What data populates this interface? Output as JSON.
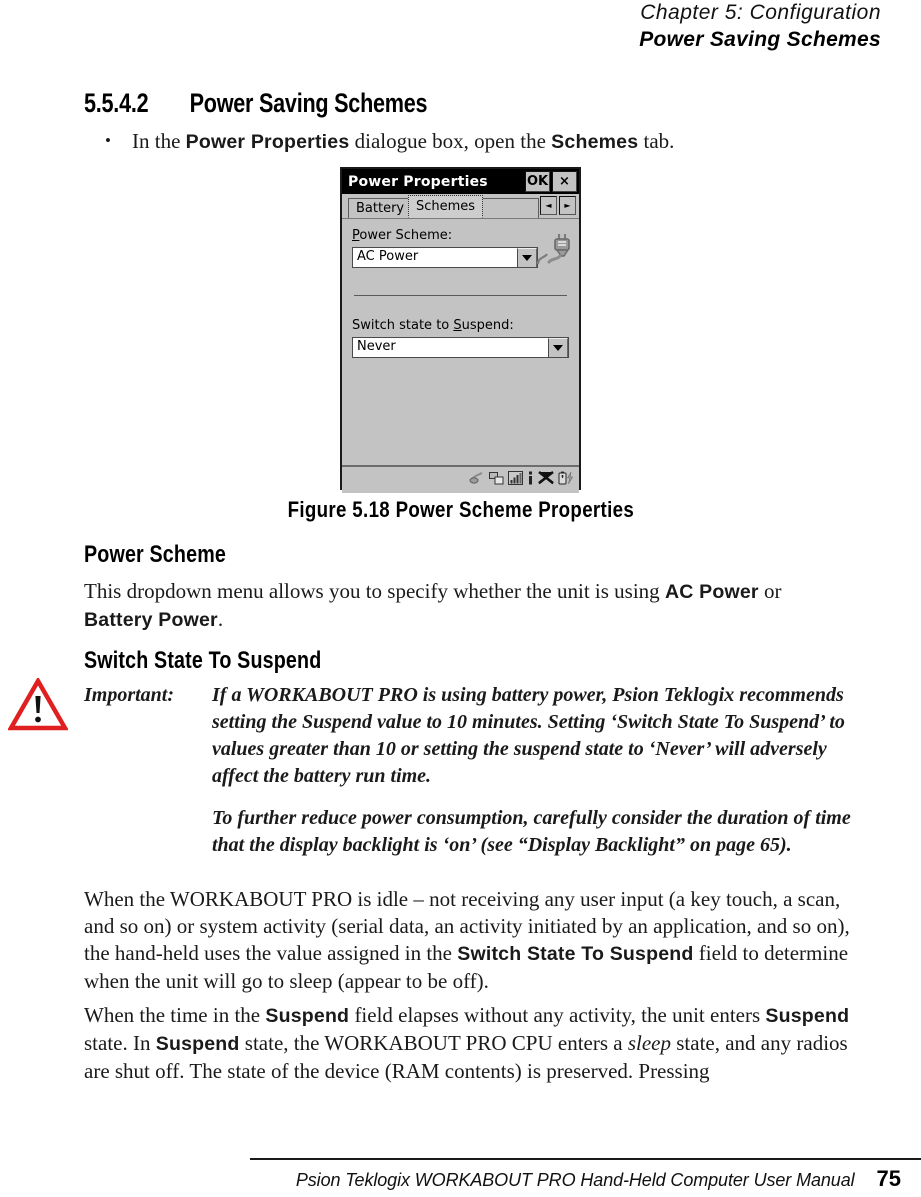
{
  "running_head": {
    "line1": "Chapter 5: Configuration",
    "line2": "Power Saving Schemes"
  },
  "section": {
    "number": "5.5.4.2",
    "title": "Power Saving Schemes"
  },
  "bullet": {
    "marker": "•",
    "text_before": "In the ",
    "term1": "Power Properties",
    "text_middle": " dialogue box, open the ",
    "term2": "Schemes",
    "text_after": " tab."
  },
  "dialog": {
    "title": "Power Properties",
    "ok_label": "OK",
    "close_label": "×",
    "tabs": [
      {
        "label": "Battery",
        "active": false
      },
      {
        "label": "Schemes",
        "active": true
      }
    ],
    "tab_scroll_left": "◄",
    "tab_scroll_right": "►",
    "fields": [
      {
        "label_pre": "P",
        "label_rest": "ower Scheme:",
        "value": "AC Power"
      },
      {
        "label_pre": "S",
        "label_rest": "witch state to ",
        "label_underline": "S",
        "label_tail": "uspend:",
        "value": "Never"
      }
    ],
    "switch_label_full": "Switch state to Suspend:",
    "tray_icons": [
      "speaker-icon",
      "network-connection-icon",
      "signal-strength-icon",
      "info-icon",
      "radio-disabled-icon",
      "battery-charging-icon"
    ],
    "plug_icon": "ac-plug-icon"
  },
  "figure": {
    "caption": "Figure 5.18  Power Scheme Properties"
  },
  "headings": {
    "power_scheme": "Power Scheme",
    "switch_state": "Switch State To Suspend"
  },
  "paragraphs": {
    "power_scheme": {
      "p1": "This dropdown menu allows you to specify whether the unit is using ",
      "term1": "AC Power",
      "p2": " or ",
      "term2": "Battery Power",
      "p3": "."
    },
    "when_idle": {
      "p1": "When the WORKABOUT PRO is idle – not receiving any user input (a key touch, a scan, and so on) or system activity (serial data, an activity initiated by an application, and so on), the hand-held uses the value assigned in the ",
      "term1": "Switch State To Suspend",
      "p2": " field to determine when the unit will go to sleep (appear to be off)."
    },
    "when_time": {
      "p1": "When the time in the ",
      "term1": "Suspend",
      "p2": " field elapses without any activity, the unit enters ",
      "term2": "Suspend",
      "p3": " state. In ",
      "term3": "Suspend",
      "p4": " state, the WORKABOUT PRO CPU enters a ",
      "italic1": "sleep",
      "p5": " state, and any radios are shut off. The state of the device (RAM contents) is preserved. Pressing"
    }
  },
  "important": {
    "label": "Important:",
    "para1": "If a WORKABOUT PRO is using battery power, Psion Teklogix recommends setting the Suspend value to 10 minutes. Setting ‘Switch State To Suspend’ to values greater than 10 or setting the suspend state to ‘Never’ will adversely affect the battery run time.",
    "para2": "To further reduce power consumption, carefully consider the duration of time that the display backlight is ‘on’ (see “Display Backlight” on page 65).",
    "icon": "warning-triangle-icon",
    "icon_color": "#e02020"
  },
  "footer": {
    "text": "Psion Teklogix WORKABOUT PRO Hand-Held Computer User Manual",
    "page": "75"
  }
}
